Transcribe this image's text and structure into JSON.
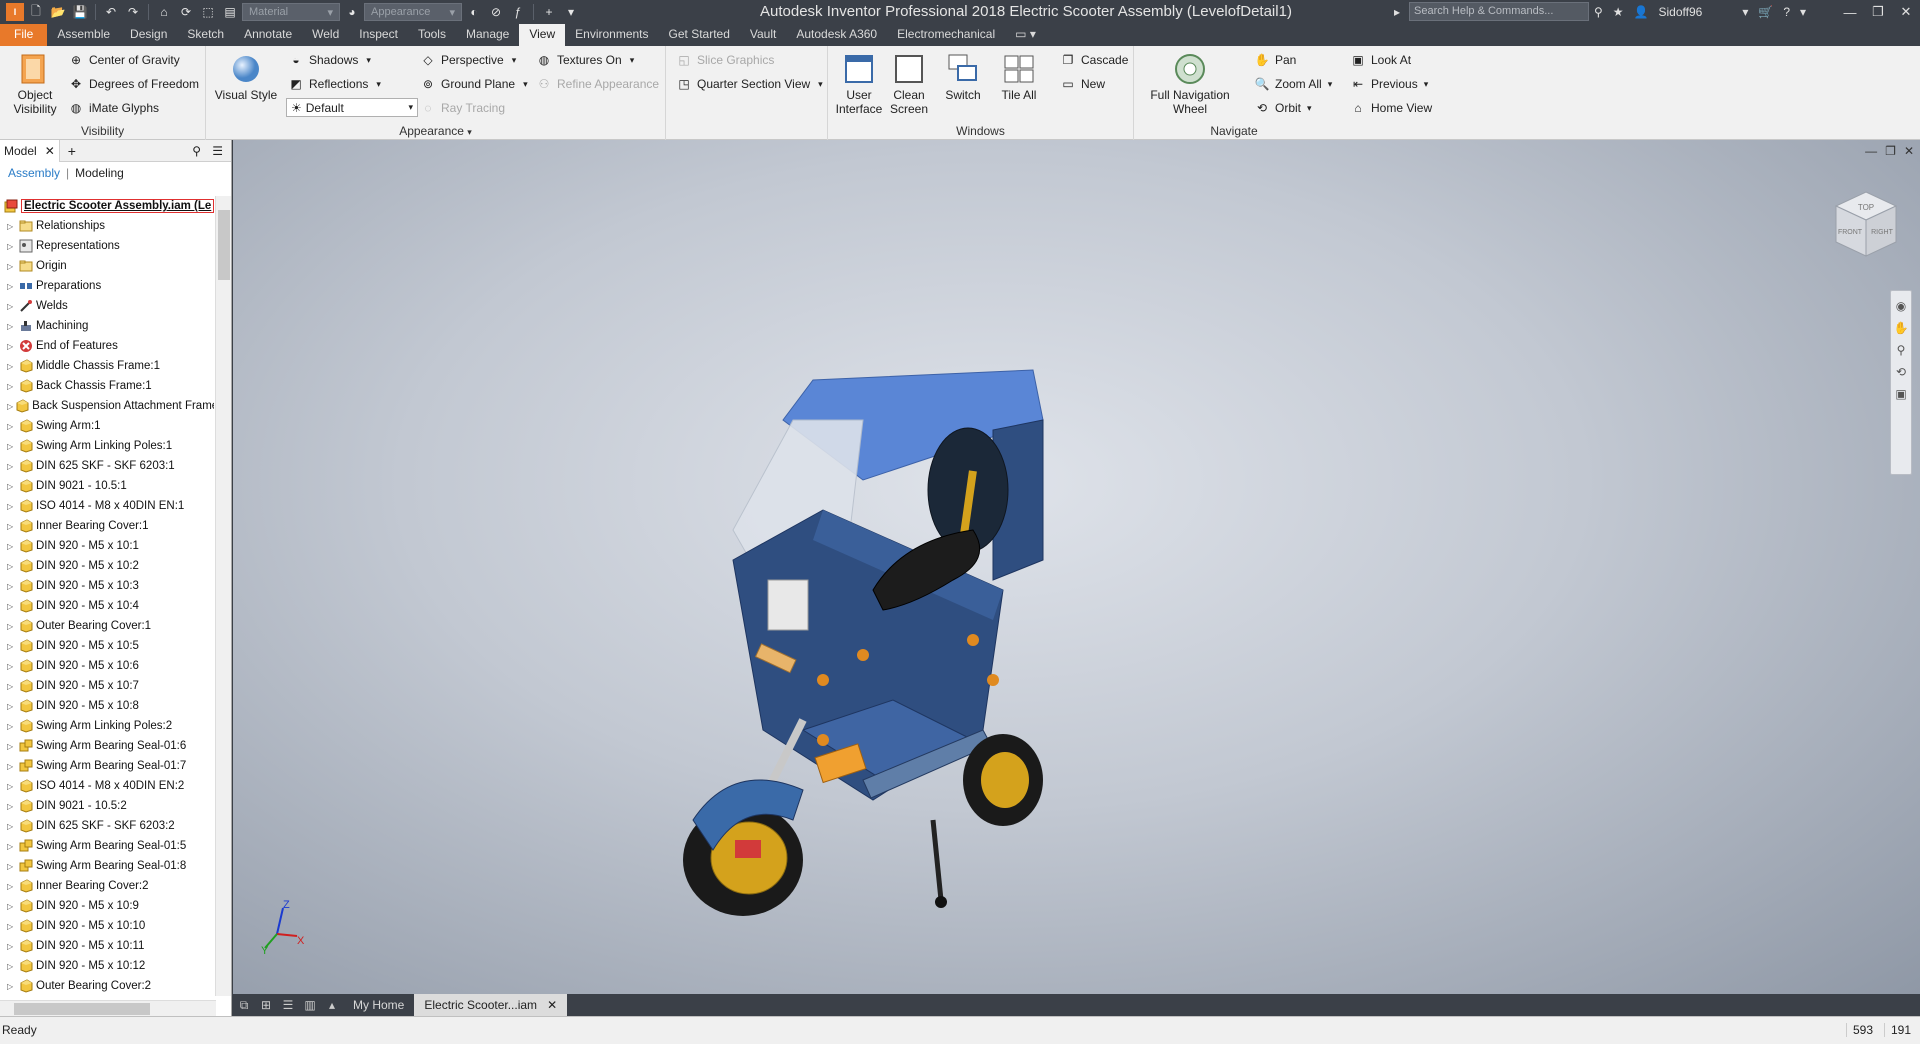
{
  "app": {
    "title": "Autodesk Inventor Professional 2018    Electric Scooter Assembly (LevelofDetail1)",
    "search_placeholder": "Search Help & Commands...",
    "user": "Sidoff96",
    "material_placeholder": "Material",
    "appearance_placeholder": "Appearance"
  },
  "tabs": [
    {
      "label": "File"
    },
    {
      "label": "Assemble"
    },
    {
      "label": "Design"
    },
    {
      "label": "Sketch"
    },
    {
      "label": "Annotate"
    },
    {
      "label": "Weld"
    },
    {
      "label": "Inspect"
    },
    {
      "label": "Tools"
    },
    {
      "label": "Manage"
    },
    {
      "label": "View"
    },
    {
      "label": "Environments"
    },
    {
      "label": "Get Started"
    },
    {
      "label": "Vault"
    },
    {
      "label": "Autodesk A360"
    },
    {
      "label": "Electromechanical"
    }
  ],
  "ribbon": {
    "visibility": {
      "label": "Visibility",
      "object_visibility": "Object Visibility",
      "center_of_gravity": "Center of Gravity",
      "degrees_of_freedom": "Degrees of Freedom",
      "imate_glyphs": "iMate Glyphs"
    },
    "appearance": {
      "label": "Appearance",
      "visual_style": "Visual Style",
      "shadows": "Shadows",
      "reflections": "Reflections",
      "default": "Default",
      "perspective": "Perspective",
      "ground_plane": "Ground Plane",
      "ray_tracing": "Ray Tracing",
      "textures_on": "Textures On",
      "refine_appearance": "Refine Appearance",
      "slice_graphics": "Slice Graphics",
      "quarter_section_view": "Quarter Section View"
    },
    "windows": {
      "label": "Windows",
      "user_interface": "User Interface",
      "clean_screen": "Clean Screen",
      "switch": "Switch",
      "tile_all": "Tile All",
      "cascade": "Cascade",
      "new": "New"
    },
    "navigate": {
      "label": "Navigate",
      "full_navigation_wheel": "Full Navigation Wheel",
      "pan": "Pan",
      "zoom_all": "Zoom All",
      "orbit": "Orbit",
      "look_at": "Look At",
      "previous": "Previous",
      "home_view": "Home View"
    }
  },
  "browser": {
    "tab": "Model",
    "sub_assembly": "Assembly",
    "sub_modeling": "Modeling",
    "root": "Electric Scooter Assembly.iam (Le",
    "items": [
      {
        "label": "Relationships",
        "icon": "folder"
      },
      {
        "label": "Representations",
        "icon": "representations"
      },
      {
        "label": "Origin",
        "icon": "folder"
      },
      {
        "label": "Preparations",
        "icon": "preparations"
      },
      {
        "label": "Welds",
        "icon": "welds"
      },
      {
        "label": "Machining",
        "icon": "machining"
      },
      {
        "label": "End of Features",
        "icon": "end"
      },
      {
        "label": "Middle Chassis Frame:1",
        "icon": "part"
      },
      {
        "label": "Back Chassis Frame:1",
        "icon": "part"
      },
      {
        "label": "Back Suspension Attachment Frame:",
        "icon": "part"
      },
      {
        "label": "Swing Arm:1",
        "icon": "part"
      },
      {
        "label": "Swing Arm Linking Poles:1",
        "icon": "part"
      },
      {
        "label": "DIN 625 SKF - SKF 6203:1",
        "icon": "part"
      },
      {
        "label": "DIN 9021 - 10.5:1",
        "icon": "part"
      },
      {
        "label": "ISO 4014 - M8 x 40DIN EN:1",
        "icon": "part"
      },
      {
        "label": "Inner Bearing  Cover:1",
        "icon": "part"
      },
      {
        "label": "DIN 920 - M5 x 10:1",
        "icon": "part"
      },
      {
        "label": "DIN 920 - M5 x 10:2",
        "icon": "part"
      },
      {
        "label": "DIN 920 - M5 x 10:3",
        "icon": "part"
      },
      {
        "label": "DIN 920 - M5 x 10:4",
        "icon": "part"
      },
      {
        "label": "Outer Bearing Cover:1",
        "icon": "part"
      },
      {
        "label": "DIN 920 - M5 x 10:5",
        "icon": "part"
      },
      {
        "label": "DIN 920 - M5 x 10:6",
        "icon": "part"
      },
      {
        "label": "DIN 920 - M5 x 10:7",
        "icon": "part"
      },
      {
        "label": "DIN 920 - M5 x 10:8",
        "icon": "part"
      },
      {
        "label": "Swing Arm Linking Poles:2",
        "icon": "part"
      },
      {
        "label": "Swing Arm Bearing Seal-01:6",
        "icon": "assembly"
      },
      {
        "label": "Swing Arm Bearing Seal-01:7",
        "icon": "assembly"
      },
      {
        "label": "ISO 4014 - M8 x 40DIN EN:2",
        "icon": "part"
      },
      {
        "label": "DIN 9021 - 10.5:2",
        "icon": "part"
      },
      {
        "label": "DIN 625 SKF - SKF 6203:2",
        "icon": "part"
      },
      {
        "label": "Swing Arm Bearing Seal-01:5",
        "icon": "assembly"
      },
      {
        "label": "Swing Arm Bearing Seal-01:8",
        "icon": "assembly"
      },
      {
        "label": "Inner Bearing  Cover:2",
        "icon": "part"
      },
      {
        "label": "DIN 920 - M5 x 10:9",
        "icon": "part"
      },
      {
        "label": "DIN 920 - M5 x 10:10",
        "icon": "part"
      },
      {
        "label": "DIN 920 - M5 x 10:11",
        "icon": "part"
      },
      {
        "label": "DIN 920 - M5 x 10:12",
        "icon": "part"
      },
      {
        "label": "Outer Bearing Cover:2",
        "icon": "part"
      }
    ]
  },
  "viewcube": {
    "top": "TOP",
    "front": "FRONT",
    "right": "RIGHT"
  },
  "triad": {
    "x": "X",
    "y": "Y",
    "z": "Z"
  },
  "doctabs": {
    "home": "My Home",
    "active": "Electric Scooter...iam"
  },
  "status": {
    "text": "Ready",
    "count1": "593",
    "count2": "191"
  },
  "colors": {
    "accent_file": "#e8792a",
    "body_blue": "#2f4e80",
    "canopy_blue": "#5a86d6",
    "brass": "#d4a21c"
  }
}
